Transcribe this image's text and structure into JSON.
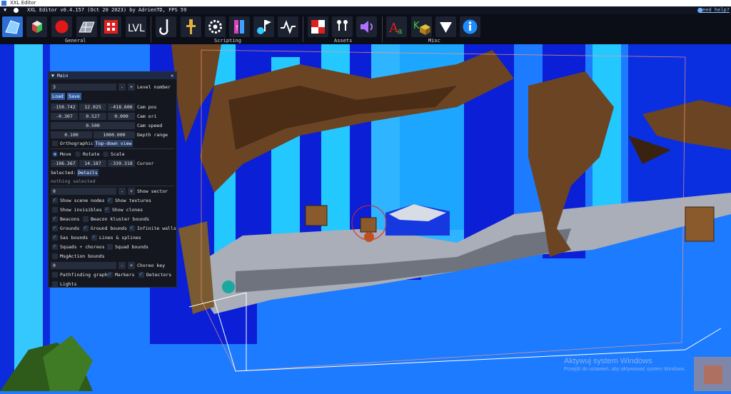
{
  "window": {
    "title": "XXL Editor"
  },
  "menubar": {
    "text": "XXL Editor v0.4.157 (Oct 20 2023) by AdrienTD, FPS 59",
    "help": "Need help?"
  },
  "toolbar": {
    "groups": {
      "general": "General",
      "scripting": "Scripting",
      "assets": "Assets",
      "misc": "Misc"
    },
    "buttons": {
      "general": [
        "scene-button",
        "model-button",
        "record-button",
        "grid-button",
        "squads-button",
        "level-button"
      ],
      "scripting": [
        "hook-button",
        "anchor-button",
        "gear-button",
        "trigger-button",
        "flag-button",
        "signal-button"
      ],
      "assets": [
        "textures-button",
        "characters-button",
        "sounds-button"
      ],
      "misc": [
        "localization-button",
        "kluster-button",
        "triangle-button",
        "about-button"
      ]
    }
  },
  "main_panel": {
    "title": "Main",
    "level_number": {
      "value": "3",
      "label": "Level number",
      "minus": "-",
      "plus": "+"
    },
    "load": "Load",
    "save": "Save",
    "cam_pos": {
      "x": "-150.742",
      "y": "12.025",
      "z": "-418.606",
      "label": "Cam pos"
    },
    "cam_ori": {
      "x": "-0.307",
      "y": "0.527",
      "z": "0.000",
      "label": "Cam ori"
    },
    "cam_speed": {
      "value": "0.500",
      "label": "Cam speed"
    },
    "depth_range": {
      "near": "0.100",
      "far": "1000.000",
      "label": "Depth range"
    },
    "orthographic": "Orthographic",
    "topdown": "Top-down view",
    "gizmo": {
      "move": "Move",
      "rotate": "Rotate",
      "scale": "Scale"
    },
    "cursor": {
      "x": "-196.367",
      "y": "14.187",
      "z": "-339.318",
      "label": "Cursor"
    },
    "selected_label": "Selected:",
    "details": "Details",
    "nothing": "nothing selected",
    "sector": {
      "value": "0",
      "label": "Show sector",
      "minus": "-",
      "plus": "+"
    },
    "checks": {
      "scene_nodes": "Show scene nodes",
      "textures": "Show textures",
      "invisibles": "Show invisibles",
      "clones": "Show clones",
      "beacons": "Beacons",
      "beacon_kluster": "Beacon kluster bounds",
      "grounds": "Grounds",
      "ground_bounds": "Ground bounds",
      "infinite_walls": "Infinite walls",
      "sas_bounds": "Sas bounds",
      "lines_splines": "Lines & splines",
      "squads_choreos": "Squads + choreos",
      "squad_bounds": "Squad bounds",
      "msgaction": "MsgAction bounds"
    },
    "choreo": {
      "value": "0",
      "label": "Choreo key",
      "minus": "-",
      "plus": "+"
    },
    "pathfinding": "Pathfinding graph",
    "markers": "Markers",
    "detectors": "Detectors",
    "lights": "Lights"
  },
  "watermark": {
    "line1": "Aktywuj system Windows",
    "line2": "Przejdź do ustawień, aby aktywować system Windows."
  },
  "colors": {
    "sky": "#1d7bff",
    "deep_blue": "#0a1fd6",
    "cyan": "#23c8ff",
    "rock": "#6b4424",
    "floor": "#a9aeb8",
    "panel": "#14171f",
    "accent": "#4f9bff"
  }
}
